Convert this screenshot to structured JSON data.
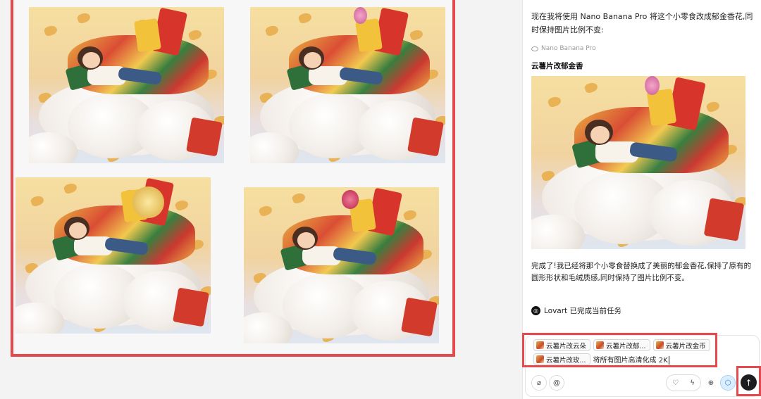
{
  "canvas": {
    "images": [
      {
        "name": "canvas-image-1",
        "variant": "cloud"
      },
      {
        "name": "canvas-image-2",
        "variant": "tulip"
      },
      {
        "name": "canvas-image-3",
        "variant": "coin"
      },
      {
        "name": "canvas-image-4",
        "variant": "rose"
      }
    ],
    "selection_color": "#e5484d"
  },
  "chat": {
    "user_message": "现在我将使用 Nano Banana Pro 将这个小零食改成郁金香花,同时保持图片比例不变:",
    "model_label": "Nano Banana Pro",
    "result_title": "云薯片改郁金香",
    "completion_message": "完成了!我已经将那个小零食替换成了美丽的郁金香花,保持了原有的圆形形状和毛绒质感,同时保持了图片比例不变。",
    "status": {
      "icon": "lovart-logo-icon",
      "text": "Lovart 已完成当前任务"
    }
  },
  "composer": {
    "chips": [
      {
        "label": "云薯片改云朵"
      },
      {
        "label": "云薯片改郁..."
      },
      {
        "label": "云薯片改金币"
      },
      {
        "label": "云薯片改玫..."
      }
    ],
    "input_text": "将所有图片高清化成 2K",
    "tools_left": [
      {
        "name": "attach-icon",
        "glyph": "⌀"
      },
      {
        "name": "mention-icon",
        "glyph": "@"
      }
    ],
    "tools_mid": [
      {
        "name": "lightbulb-icon",
        "glyph": "♡"
      },
      {
        "name": "lightning-icon",
        "glyph": "ϟ"
      }
    ],
    "tools_right": [
      {
        "name": "globe-icon",
        "glyph": "⊕"
      },
      {
        "name": "cube-icon",
        "glyph": "⬡"
      }
    ],
    "send_glyph": "↑"
  }
}
